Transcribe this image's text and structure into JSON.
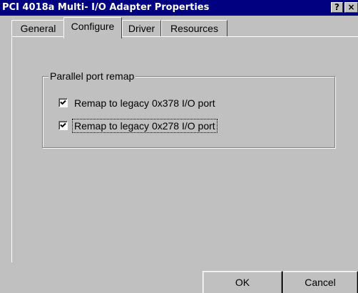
{
  "window": {
    "title": "PCI 4018a Multi- I/O Adapter Properties",
    "help_glyph": "?",
    "close_glyph": "×"
  },
  "tabs": [
    {
      "label": "General",
      "selected": false
    },
    {
      "label": "Configure",
      "selected": true
    },
    {
      "label": "Driver",
      "selected": false
    },
    {
      "label": "Resources",
      "selected": false
    }
  ],
  "group": {
    "label": "Parallel port remap",
    "options": [
      {
        "label": "Remap to legacy 0x378 I/O port",
        "checked": true
      },
      {
        "label": "Remap to legacy 0x278 I/O port",
        "checked": true
      }
    ]
  },
  "buttons": {
    "ok": "OK",
    "cancel": "Cancel"
  },
  "colors": {
    "titlebar": "#000080",
    "face": "#c0c0c0"
  }
}
